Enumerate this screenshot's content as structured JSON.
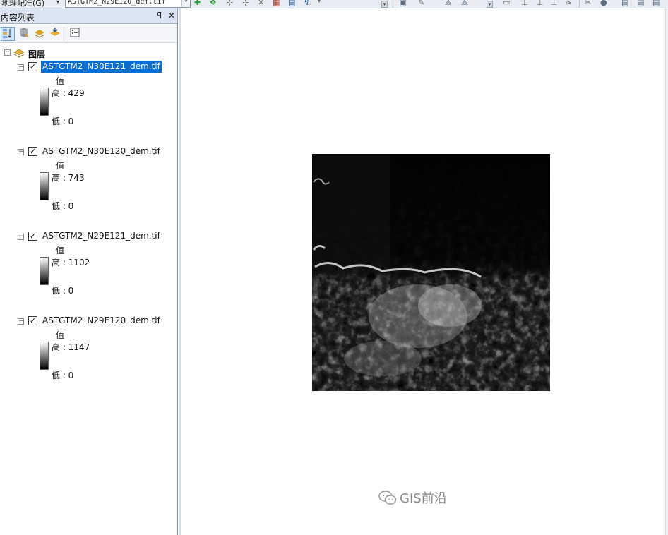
{
  "toolbar": {
    "menu_label": "地理配准(G)",
    "layer_combo_value": "ASTGTM2_N29E120_dem.tif",
    "icons": [
      "add-control-point-icon",
      "link-table-icon",
      "rotate-icon",
      "shift-icon",
      "scale-icon",
      "view-link-table-icon",
      "dropdown-icon",
      "edit-icon",
      "select-icon",
      "identify-icon",
      "gis-tools-icon"
    ]
  },
  "toc": {
    "title": "内容列表",
    "pin_glyph": "ᵖ",
    "close_glyph": "✕",
    "tools": [
      "list-by-drawing-order-icon",
      "list-by-source-icon",
      "list-by-visibility-icon",
      "list-by-selection-icon",
      "options-icon"
    ],
    "group": {
      "label": "图层",
      "expanded": true
    },
    "layers": [
      {
        "name": "ASTGTM2_N30E121_dem.tif",
        "checked": true,
        "selected": true,
        "value_label": "值",
        "high_label": "高 : 429",
        "low_label": "低 : 0"
      },
      {
        "name": "ASTGTM2_N30E120_dem.tif",
        "checked": true,
        "selected": false,
        "value_label": "值",
        "high_label": "高 : 743",
        "low_label": "低 : 0"
      },
      {
        "name": "ASTGTM2_N29E121_dem.tif",
        "checked": true,
        "selected": false,
        "value_label": "值",
        "high_label": "高 : 1102",
        "low_label": "低 : 0"
      },
      {
        "name": "ASTGTM2_N29E120_dem.tif",
        "checked": true,
        "selected": false,
        "value_label": "值",
        "high_label": "高 : 1147",
        "low_label": "低 : 0"
      }
    ]
  },
  "map": {
    "background": "#ffffff",
    "raster_description_icon": "dem-raster-image"
  },
  "watermark": {
    "text": "GIS前沿",
    "icon": "wechat-icon"
  },
  "colors": {
    "selection": "#0a6ed1",
    "panel_header": "#dbe4f2",
    "watermark_gray": "#8a8a8a"
  }
}
